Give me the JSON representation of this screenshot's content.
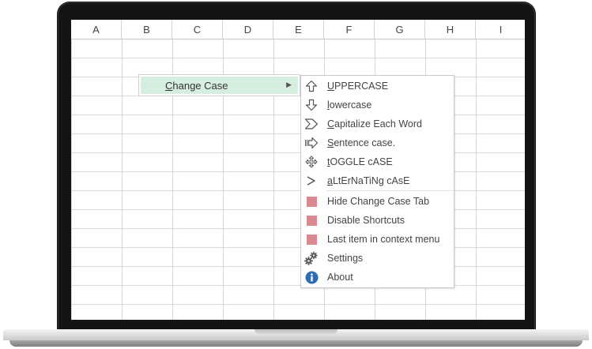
{
  "spreadsheet": {
    "columns": [
      "A",
      "B",
      "C",
      "D",
      "E",
      "F",
      "G",
      "H",
      "I"
    ]
  },
  "context_menu": {
    "item_label": "Change Case",
    "item_mnemonic": "C",
    "item_rest": "hange Case",
    "submenu_arrow": "▶"
  },
  "submenu": {
    "items": [
      {
        "id": "uppercase",
        "label": "UPPERCASE",
        "mnemonic": "U",
        "rest": "PPERCASE",
        "icon": "arrow-up-outline-icon"
      },
      {
        "id": "lowercase",
        "label": "lowercase",
        "mnemonic": "l",
        "rest": "owercase",
        "icon": "arrow-down-outline-icon"
      },
      {
        "id": "capitalize",
        "label": "Capitalize Each Word",
        "mnemonic": "C",
        "rest": "apitalize Each Word",
        "icon": "chevron-right-outline-icon"
      },
      {
        "id": "sentence",
        "label": "Sentence case.",
        "mnemonic": "S",
        "rest": "entence case.",
        "icon": "arrow-right-outline-icon"
      },
      {
        "id": "toggle",
        "label": "tOGGLE cASE",
        "mnemonic": "t",
        "rest": "OGGLE cASE",
        "icon": "move-arrows-icon"
      },
      {
        "id": "alternating",
        "label": "aLtErNaTiNg cAsE",
        "mnemonic": "a",
        "rest": "LtErNaTiNg cAsE",
        "icon": "chevron-right-icon"
      }
    ],
    "options": [
      {
        "id": "hide-tab",
        "label": "Hide Change Case Tab",
        "icon": "checkbox-square-icon"
      },
      {
        "id": "disable-shortcuts",
        "label": "Disable Shortcuts",
        "icon": "checkbox-square-icon"
      },
      {
        "id": "last-item",
        "label": "Last item in context menu",
        "icon": "checkbox-square-icon"
      },
      {
        "id": "settings",
        "label": "Settings",
        "icon": "gears-icon"
      },
      {
        "id": "about",
        "label": "About",
        "icon": "info-icon"
      }
    ]
  },
  "colors": {
    "highlight": "#d5eee0",
    "option_square": "#d9898f",
    "info_blue": "#2e6db4",
    "bezel": "#141414"
  }
}
